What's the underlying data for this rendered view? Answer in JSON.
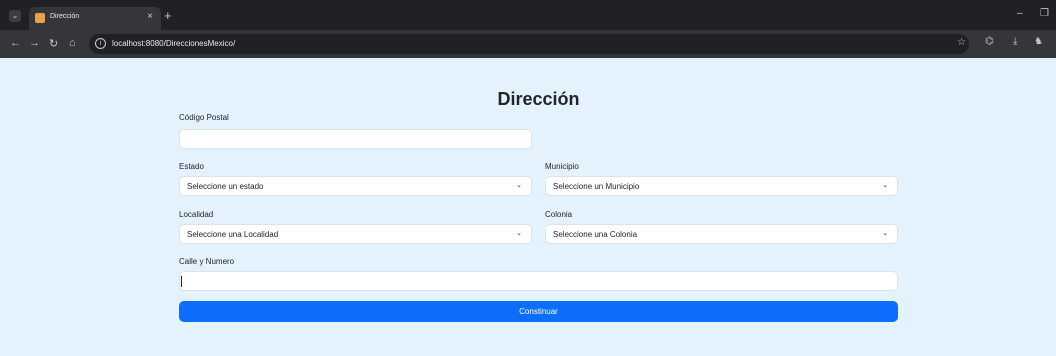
{
  "browser": {
    "tab_title": "Dirección",
    "tab_close": "×",
    "new_tab": "+",
    "menu_glyph": "⌄",
    "url": "localhost:8080/DireccionesMexico/",
    "window_controls": {
      "minimize": "–",
      "restore": "❐"
    },
    "nav": {
      "back": "←",
      "forward": "→",
      "reload": "↻",
      "home": "⌂"
    },
    "toolbar_icons": {
      "star": "☆",
      "extensions": "⌬",
      "download": "⤓",
      "profile": "♞"
    },
    "info_glyph": "i"
  },
  "form": {
    "title": "Dirección",
    "postal_code": {
      "label": "Código Postal",
      "value": ""
    },
    "estado": {
      "label": "Estado",
      "selected": "Seleccione un estado"
    },
    "municipio": {
      "label": "Municipio",
      "selected": "Seleccione un Municipio"
    },
    "localidad": {
      "label": "Localidad",
      "selected": "Seleccione una Localidad"
    },
    "colonia": {
      "label": "Colonia",
      "selected": "Seleccione una Colonia"
    },
    "calle": {
      "label": "Calle y Numero",
      "value": ""
    },
    "submit_label": "Constinuar",
    "chevron": "⌄"
  },
  "colors": {
    "background": "#e3f2fd",
    "primary": "#0d6efd",
    "chrome_dark": "#202124",
    "chrome_toolbar": "#35363a"
  }
}
